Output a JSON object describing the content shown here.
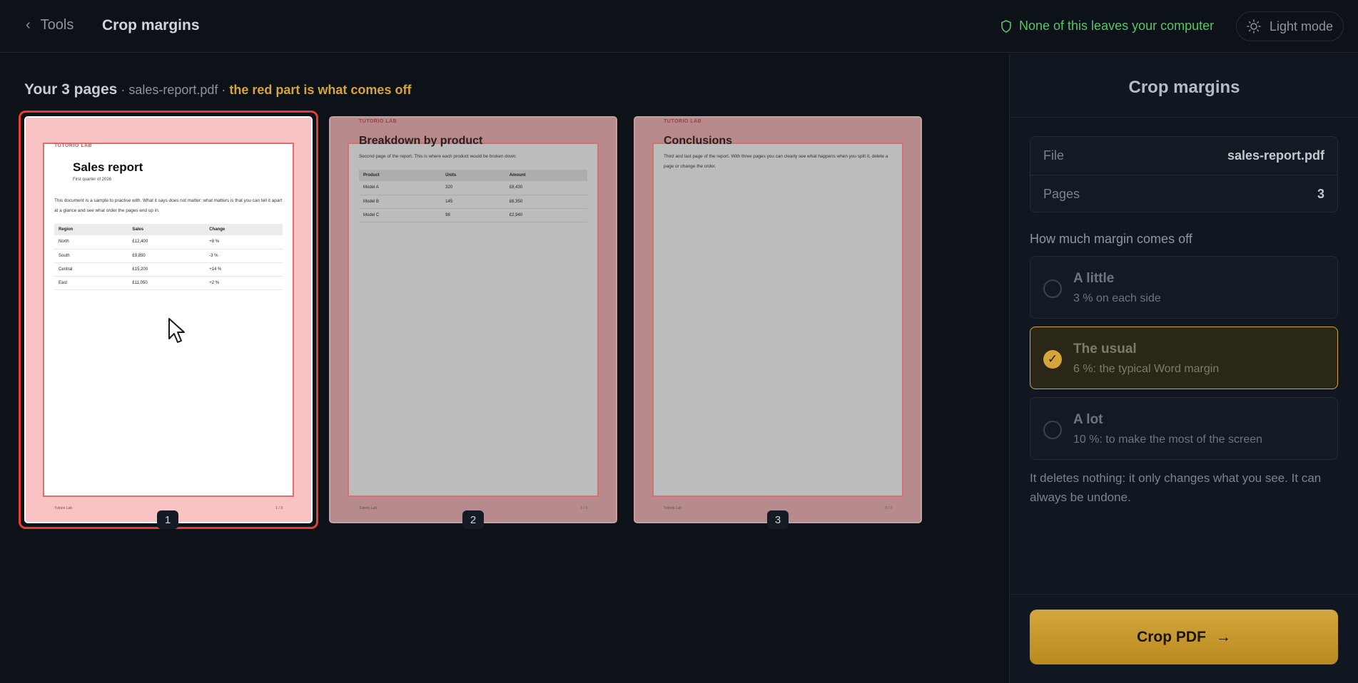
{
  "header": {
    "back_label": "Tools",
    "title": "Crop margins",
    "privacy_text": "None of this leaves your computer",
    "theme_button": "Light mode"
  },
  "main": {
    "count_label": "Your 3 pages",
    "file_part": " · sales-report.pdf · ",
    "note": "the red part is what comes off",
    "pages": [
      {
        "number": "1",
        "brand": "TUTORIO LAB",
        "title": "Sales report",
        "subtitle": "First quarter of 2026",
        "text": "This document is a sample to practise with. What it says does not matter: what matters is that you can tell it apart at a glance and see what order the pages end up in.",
        "table": {
          "headers": [
            "Region",
            "Sales",
            "Change"
          ],
          "rows": [
            [
              "North",
              "£12,400",
              "+8 %"
            ],
            [
              "South",
              "£9,850",
              "-3 %"
            ],
            [
              "Central",
              "£15,200",
              "+14 %"
            ],
            [
              "East",
              "£11,050",
              "+2 %"
            ]
          ]
        },
        "footer_left": "Tutorio Lab",
        "footer_right": "1 / 3"
      },
      {
        "number": "2",
        "brand": "TUTORIO LAB",
        "title": "Breakdown by product",
        "text": "Second page of the report. This is where each product would be broken down.",
        "table": {
          "headers": [
            "Product",
            "Units",
            "Amount"
          ],
          "rows": [
            [
              "Model A",
              "320",
              "£8,430"
            ],
            [
              "Model B",
              "145",
              "£6,350"
            ],
            [
              "Model C",
              "98",
              "£2,940"
            ]
          ]
        },
        "footer_left": "Tutorio Lab",
        "footer_right": "2 / 3"
      },
      {
        "number": "3",
        "brand": "TUTORIO LAB",
        "title": "Conclusions",
        "text": "Third and last page of the report. With three pages you can clearly see what happens when you split it, delete a page or change the order.",
        "footer_left": "Tutorio Lab",
        "footer_right": "3 / 3"
      }
    ]
  },
  "sidebar": {
    "title": "Crop margins",
    "file_label": "File",
    "file_value": "sales-report.pdf",
    "pages_label": "Pages",
    "pages_value": "3",
    "section_label": "How much margin comes off",
    "options": [
      {
        "title": "A little",
        "desc": "3 % on each side",
        "selected": false
      },
      {
        "title": "The usual",
        "desc": "6 %: the typical Word margin",
        "selected": true
      },
      {
        "title": "A lot",
        "desc": "10 %: to make the most of the screen",
        "selected": false
      }
    ],
    "check_mark": "✓",
    "note": "It deletes nothing: it only changes what you see. It can always be undone.",
    "button_label": "Crop PDF",
    "button_arrow": "→"
  },
  "colors": {
    "accent": "#d6a53a",
    "privacy_green": "#5cc26a",
    "selection_red": "#e83c2e"
  },
  "icons": [
    "chevron-left-icon",
    "shield-icon",
    "sun-icon",
    "check-icon",
    "arrow-right-icon",
    "mouse-cursor-icon"
  ]
}
